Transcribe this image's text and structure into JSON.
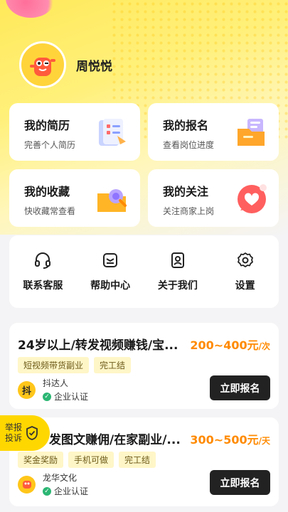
{
  "user": {
    "name": "周悦悦",
    "avatar_icon": "mascot-avatar"
  },
  "cards": [
    {
      "title": "我的简历",
      "subtitle": "完善个人简历",
      "icon": "resume-icon"
    },
    {
      "title": "我的报名",
      "subtitle": "查看岗位进度",
      "icon": "folder-icon"
    },
    {
      "title": "我的收藏",
      "subtitle": "快收藏常查看",
      "icon": "favorites-icon"
    },
    {
      "title": "我的关注",
      "subtitle": "关注商家上岗",
      "icon": "heart-chat-icon"
    }
  ],
  "services": [
    {
      "label": "联系客服",
      "icon": "headset-icon"
    },
    {
      "label": "帮助中心",
      "icon": "help-icon"
    },
    {
      "label": "关于我们",
      "icon": "about-icon"
    },
    {
      "label": "设置",
      "icon": "gear-icon"
    }
  ],
  "jobs": [
    {
      "title": "24岁以上/转发视频赚钱/宝...",
      "pay": "200~400元",
      "pay_unit": "/次",
      "tags": [
        "短视频带货副业",
        "完工结"
      ],
      "poster": "抖达人",
      "poster_logo": "抖",
      "verify": "企业认证",
      "apply_label": "立即报名"
    },
    {
      "title": "发图文赚佣/在家副业/...",
      "pay": "300~500元",
      "pay_unit": "/天",
      "tags": [
        "奖金奖励",
        "手机可做",
        "完工结"
      ],
      "poster": "龙华文化",
      "poster_logo": "",
      "verify": "企业认证",
      "apply_label": "立即报名"
    }
  ],
  "report": {
    "label": "举报投诉"
  },
  "colors": {
    "accent": "#ffd700",
    "pay": "#ff8a00",
    "button": "#222222"
  }
}
